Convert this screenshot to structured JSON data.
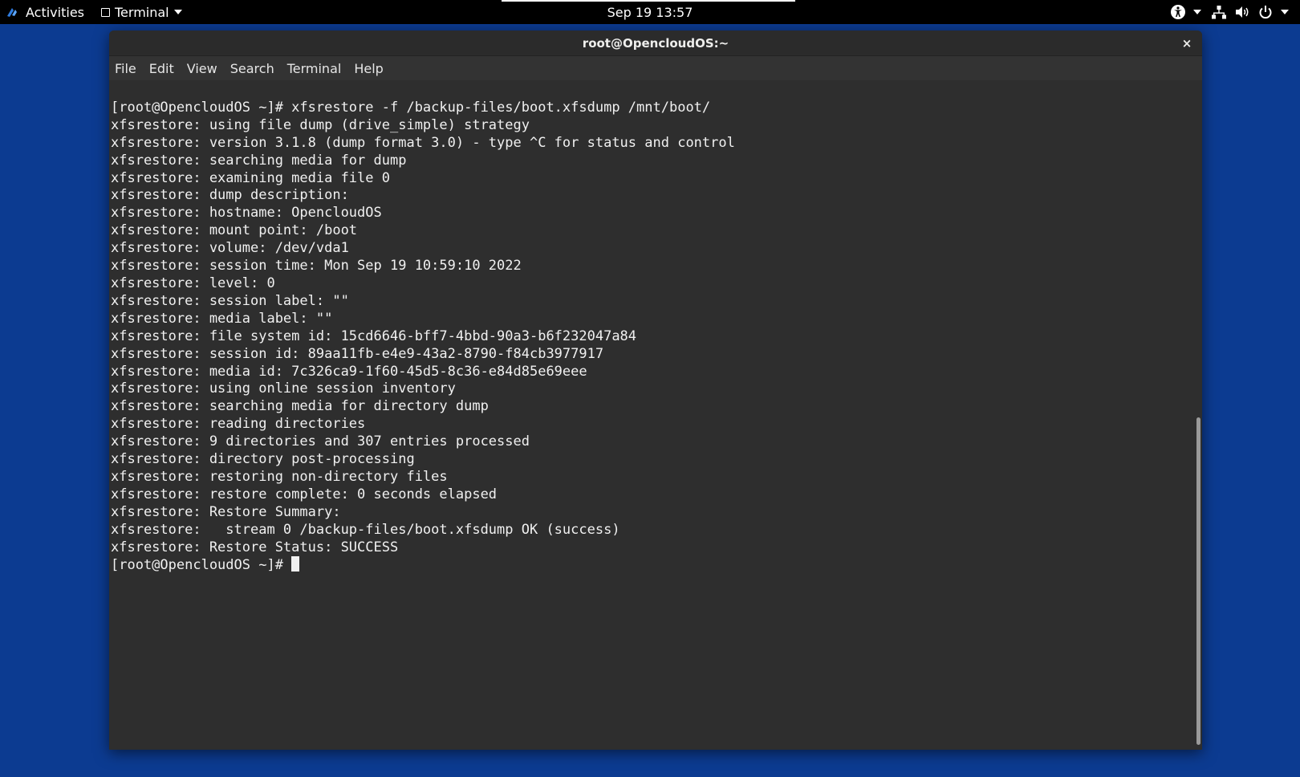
{
  "topbar": {
    "activities_label": "Activities",
    "app_menu_label": "Terminal",
    "clock": "Sep 19  13:57",
    "icons": [
      "accessibility-icon",
      "network-icon",
      "volume-icon",
      "power-icon"
    ]
  },
  "window": {
    "title": "root@OpencloudOS:~",
    "close_glyph": "×"
  },
  "menubar": {
    "items": [
      "File",
      "Edit",
      "View",
      "Search",
      "Terminal",
      "Help"
    ]
  },
  "terminal": {
    "lines": [
      "[root@OpencloudOS ~]# xfsrestore -f /backup-files/boot.xfsdump /mnt/boot/",
      "xfsrestore: using file dump (drive_simple) strategy",
      "xfsrestore: version 3.1.8 (dump format 3.0) - type ^C for status and control",
      "xfsrestore: searching media for dump",
      "xfsrestore: examining media file 0",
      "xfsrestore: dump description:",
      "xfsrestore: hostname: OpencloudOS",
      "xfsrestore: mount point: /boot",
      "xfsrestore: volume: /dev/vda1",
      "xfsrestore: session time: Mon Sep 19 10:59:10 2022",
      "xfsrestore: level: 0",
      "xfsrestore: session label: \"\"",
      "xfsrestore: media label: \"\"",
      "xfsrestore: file system id: 15cd6646-bff7-4bbd-90a3-b6f232047a84",
      "xfsrestore: session id: 89aa11fb-e4e9-43a2-8790-f84cb3977917",
      "xfsrestore: media id: 7c326ca9-1f60-45d5-8c36-e84d85e69eee",
      "xfsrestore: using online session inventory",
      "xfsrestore: searching media for directory dump",
      "xfsrestore: reading directories",
      "xfsrestore: 9 directories and 307 entries processed",
      "xfsrestore: directory post-processing",
      "xfsrestore: restoring non-directory files",
      "xfsrestore: restore complete: 0 seconds elapsed",
      "xfsrestore: Restore Summary:",
      "xfsrestore:   stream 0 /backup-files/boot.xfsdump OK (success)",
      "xfsrestore: Restore Status: SUCCESS"
    ],
    "prompt": "[root@OpencloudOS ~]# "
  },
  "colors": {
    "desktop": "#0c3b91",
    "terminal_bg": "#2e2e2e",
    "terminal_fg": "#f0f0f0"
  }
}
